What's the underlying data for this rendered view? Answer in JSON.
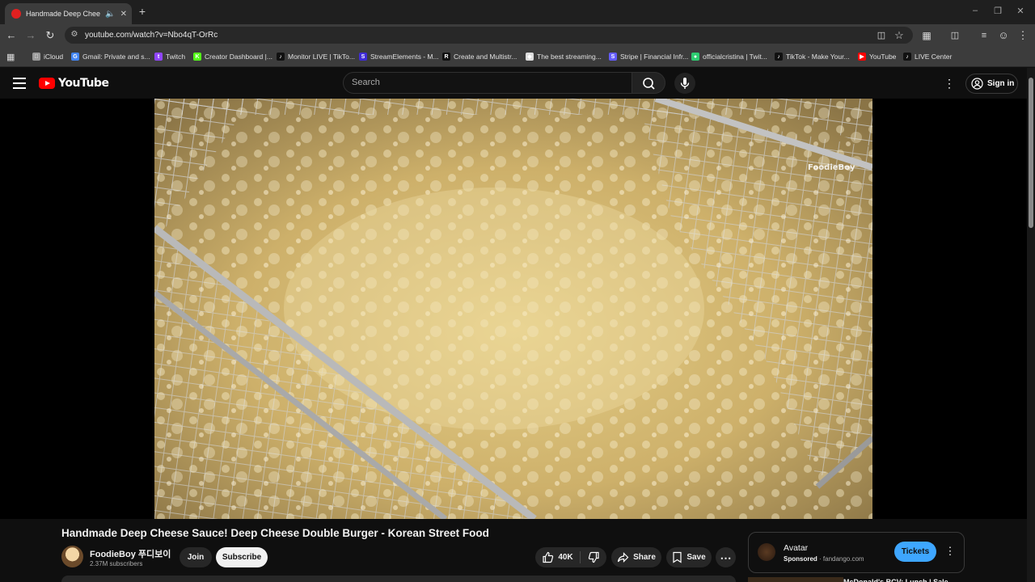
{
  "browser": {
    "tab_title": "Handmade Deep Cheese Sa",
    "new_tab": "+",
    "url": "youtube.com/watch?v=Nbo4qT-OrRc",
    "bookmarks": [
      {
        "label": "iCloud",
        "icon": "apple-icon",
        "color": "#9a9a9a"
      },
      {
        "label": "Gmail: Private and s...",
        "icon": "google-icon",
        "color": "#4285f4"
      },
      {
        "label": "Twitch",
        "icon": "twitch-icon",
        "color": "#9146ff"
      },
      {
        "label": "Creator Dashboard |...",
        "icon": "kick-icon",
        "color": "#53fc18"
      },
      {
        "label": "Monitor LIVE | TikTo...",
        "icon": "tiktok-icon",
        "color": "#111111"
      },
      {
        "label": "StreamElements - M...",
        "icon": "streamelements-icon",
        "color": "#3f2bd6"
      },
      {
        "label": "Create and Multistr...",
        "icon": "restream-icon",
        "color": "#111111"
      },
      {
        "label": "The best streaming...",
        "icon": "diamond-icon",
        "color": "#dddddd"
      },
      {
        "label": "Stripe | Financial Infr...",
        "icon": "stripe-icon",
        "color": "#635bff"
      },
      {
        "label": "officialcristina | Twit...",
        "icon": "globe-icon",
        "color": "#2ecc71"
      },
      {
        "label": "TikTok - Make Your...",
        "icon": "tiktok-icon",
        "color": "#111111"
      },
      {
        "label": "YouTube",
        "icon": "youtube-icon",
        "color": "#ff0000"
      },
      {
        "label": "LIVE Center",
        "icon": "tiktok-icon",
        "color": "#111111"
      }
    ]
  },
  "youtube": {
    "logo_text": "YouTube",
    "search_placeholder": "Search",
    "sign_in": "Sign in"
  },
  "video": {
    "watermark": "FoodieBoy",
    "title": "Handmade Deep Cheese Sauce! Deep Cheese Double Burger - Korean Street Food",
    "channel_name": "FoodieBoy 푸디보이",
    "subscribers": "2.37M subscribers",
    "join": "Join",
    "subscribe": "Subscribe",
    "likes": "40K",
    "share": "Share",
    "save": "Save"
  },
  "ad": {
    "title": "Avatar",
    "sponsored": "Sponsored",
    "domain": "fandango.com",
    "cta": "Tickets"
  },
  "next_video_title": "McDonald's BCV: Lunch | Sale..."
}
